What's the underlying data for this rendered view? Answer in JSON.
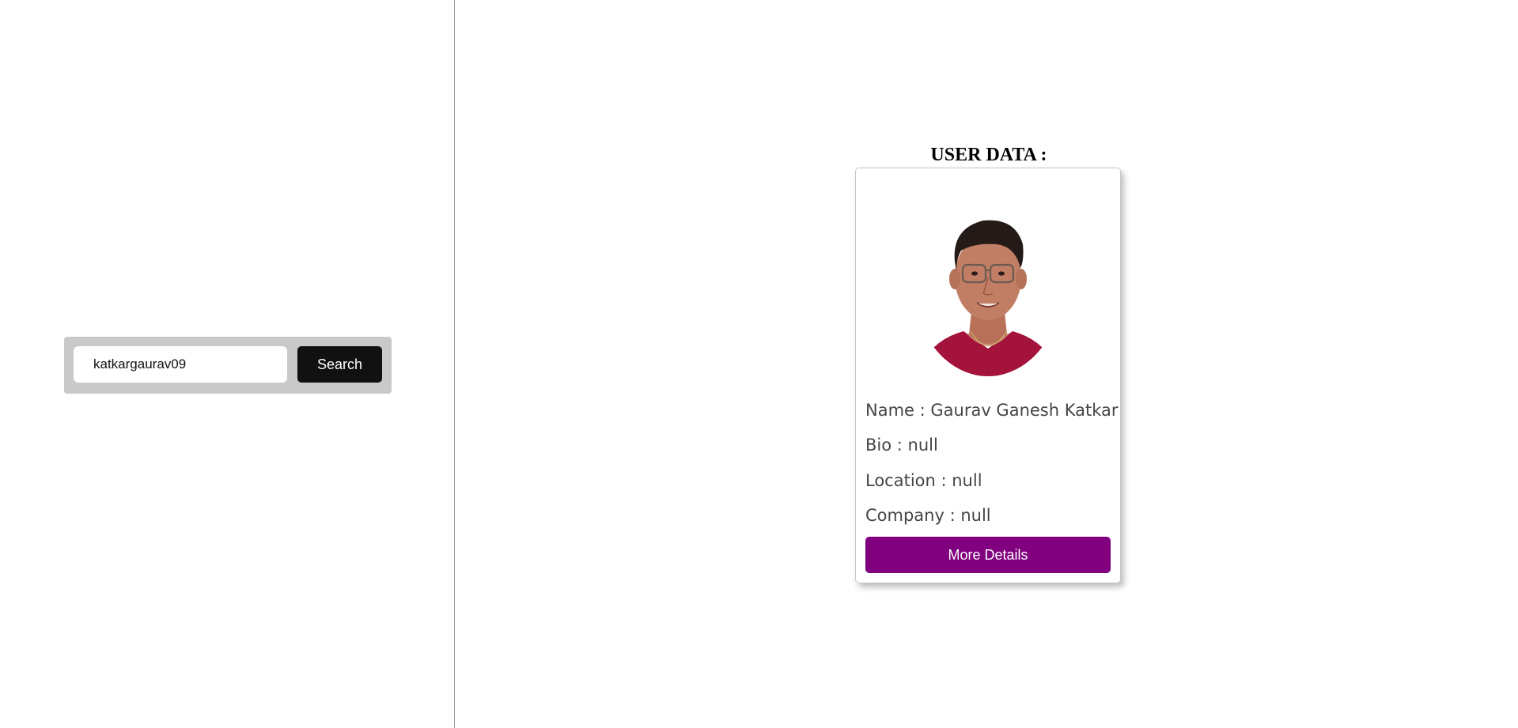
{
  "search": {
    "value": "katkargaurav09",
    "button_label": "Search"
  },
  "user_data": {
    "title": "USER DATA :",
    "name_line": "Name : Gaurav Ganesh Katkar",
    "bio_line": "Bio : null",
    "location_line": "Location : null",
    "company_line": "Company : null",
    "more_button_label": "More Details"
  },
  "colors": {
    "search_panel_bg": "#c9c9c9",
    "search_button_bg": "#111111",
    "more_button_bg": "#800080",
    "info_text": "#454545"
  }
}
